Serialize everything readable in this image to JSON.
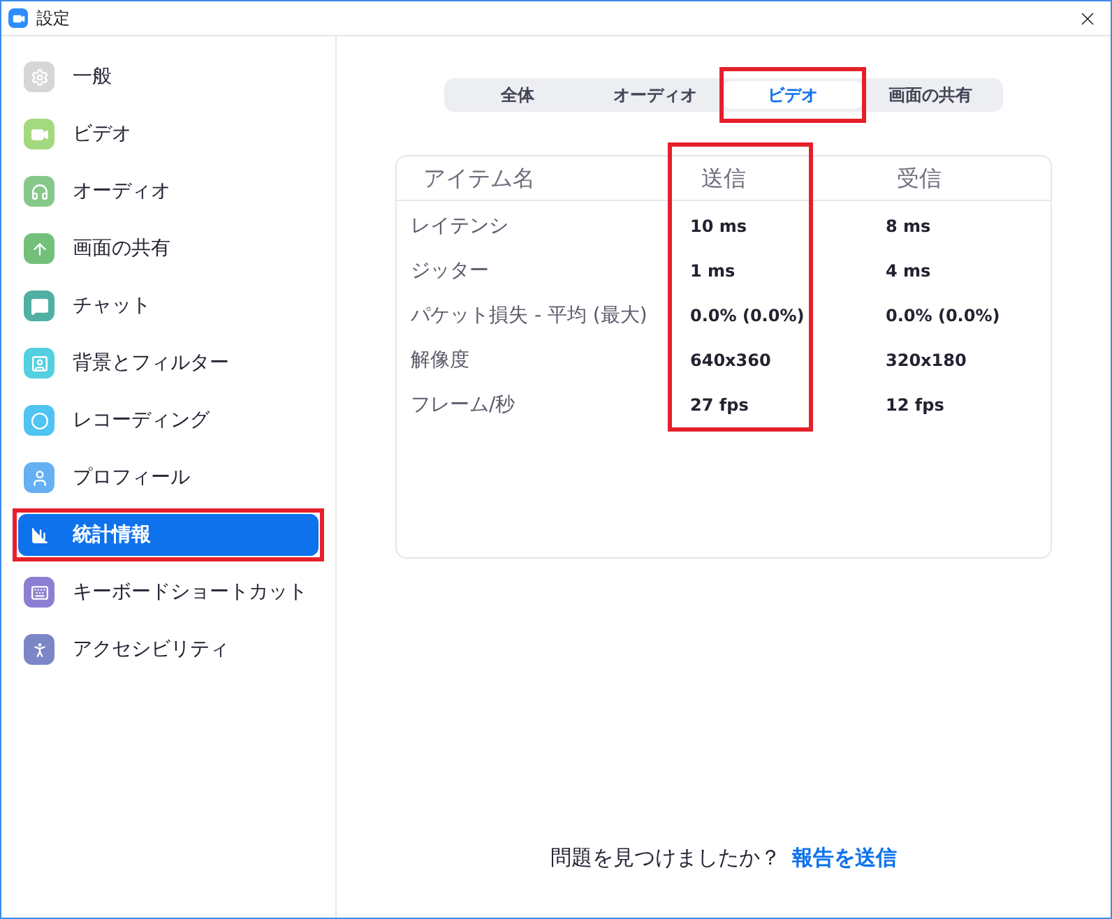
{
  "window": {
    "title": "設定"
  },
  "sidebar": {
    "items": [
      {
        "label": "一般",
        "kind": "general",
        "color": "#d6d6d6",
        "selected": false,
        "highlighted": false
      },
      {
        "label": "ビデオ",
        "kind": "video",
        "color": "#a3d97f",
        "selected": false,
        "highlighted": false
      },
      {
        "label": "オーディオ",
        "kind": "audio",
        "color": "#86c889",
        "selected": false,
        "highlighted": false
      },
      {
        "label": "画面の共有",
        "kind": "share",
        "color": "#72c07a",
        "selected": false,
        "highlighted": false
      },
      {
        "label": "チャット",
        "kind": "chat",
        "color": "#4fb0a3",
        "selected": false,
        "highlighted": false
      },
      {
        "label": "背景とフィルター",
        "kind": "background",
        "color": "#52d0df",
        "selected": false,
        "highlighted": false
      },
      {
        "label": "レコーディング",
        "kind": "recording",
        "color": "#4fc3f2",
        "selected": false,
        "highlighted": false
      },
      {
        "label": "プロフィール",
        "kind": "profile",
        "color": "#65b0f2",
        "selected": false,
        "highlighted": false
      },
      {
        "label": "統計情報",
        "kind": "statistics",
        "color": "#0e72ed",
        "selected": true,
        "highlighted": true
      },
      {
        "label": "キーボードショートカット",
        "kind": "keyboard",
        "color": "#8c7fd2",
        "selected": false,
        "highlighted": false
      },
      {
        "label": "アクセシビリティ",
        "kind": "accessibility",
        "color": "#7b86c6",
        "selected": false,
        "highlighted": false
      }
    ]
  },
  "tabs": [
    {
      "label": "全体",
      "selected": false,
      "highlighted": false
    },
    {
      "label": "オーディオ",
      "selected": false,
      "highlighted": false
    },
    {
      "label": "ビデオ",
      "selected": true,
      "highlighted": true
    },
    {
      "label": "画面の共有",
      "selected": false,
      "highlighted": false
    }
  ],
  "table": {
    "columns": [
      {
        "label": "アイテム名",
        "highlighted": false
      },
      {
        "label": "送信",
        "highlighted": true
      },
      {
        "label": "受信",
        "highlighted": false
      }
    ],
    "rows": [
      [
        "レイテンシ",
        "10 ms",
        "8 ms"
      ],
      [
        "ジッター",
        "1 ms",
        "4 ms"
      ],
      [
        "パケット損失 - 平均 (最大)",
        "0.0% (0.0%)",
        "0.0% (0.0%)"
      ],
      [
        "解像度",
        "640x360",
        "320x180"
      ],
      [
        "フレーム/秒",
        "27 fps",
        "12 fps"
      ]
    ]
  },
  "footer": {
    "question": "問題を見つけましたか？",
    "link": "報告を送信"
  }
}
